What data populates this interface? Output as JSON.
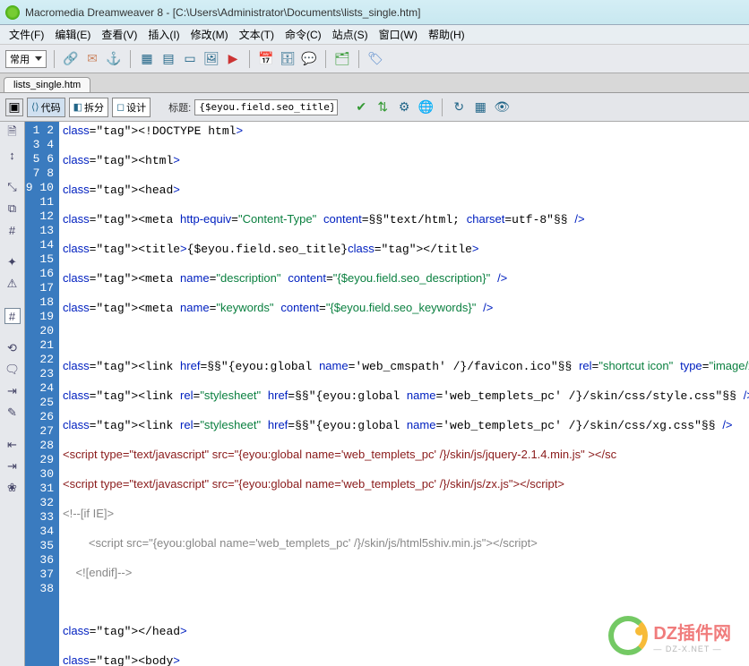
{
  "window": {
    "title": "Macromedia Dreamweaver 8 - [C:\\Users\\Administrator\\Documents\\lists_single.htm]"
  },
  "menus": [
    "文件(F)",
    "编辑(E)",
    "查看(V)",
    "插入(I)",
    "修改(M)",
    "文本(T)",
    "命令(C)",
    "站点(S)",
    "窗口(W)",
    "帮助(H)"
  ],
  "toolbar1": {
    "group_label": "常用"
  },
  "tab": {
    "filename": "lists_single.htm"
  },
  "toolbar2": {
    "code_label": "代码",
    "split_label": "拆分",
    "design_label": "设计",
    "title_label": "标题:",
    "title_value": "{$eyou.field.seo_title}"
  },
  "code_lines": [
    {
      "n": 1,
      "t": "doctype",
      "s": "<!DOCTYPE html>"
    },
    {
      "n": 2,
      "t": "blank",
      "s": ""
    },
    {
      "n": 3,
      "t": "tag",
      "s": "<html>"
    },
    {
      "n": 4,
      "t": "blank",
      "s": ""
    },
    {
      "n": 5,
      "t": "tag",
      "s": "<head>"
    },
    {
      "n": 6,
      "t": "blank",
      "s": ""
    },
    {
      "n": 7,
      "t": "meta",
      "s": "<meta http-equiv=\"Content-Type\" content=\"text/html; charset=utf-8\" />"
    },
    {
      "n": 8,
      "t": "blank",
      "s": ""
    },
    {
      "n": 9,
      "t": "title",
      "s": "<title>{$eyou.field.seo_title}</title>"
    },
    {
      "n": 10,
      "t": "blank",
      "s": ""
    },
    {
      "n": 11,
      "t": "meta",
      "s": "<meta name=\"description\" content=\"{$eyou.field.seo_description}\" />"
    },
    {
      "n": 12,
      "t": "blank",
      "s": ""
    },
    {
      "n": 13,
      "t": "meta",
      "s": "<meta name=\"keywords\" content=\"{$eyou.field.seo_keywords}\" />"
    },
    {
      "n": 14,
      "t": "blank",
      "s": ""
    },
    {
      "n": 15,
      "t": "blank",
      "s": ""
    },
    {
      "n": 16,
      "t": "blank",
      "s": ""
    },
    {
      "n": 17,
      "t": "link",
      "s": "<link href=\"{eyou:global name='web_cmspath' /}/favicon.ico\" rel=\"shortcut icon\" type=\"image/x-icon\" />"
    },
    {
      "n": 18,
      "t": "blank",
      "s": ""
    },
    {
      "n": 19,
      "t": "link",
      "s": "<link rel=\"stylesheet\" href=\"{eyou:global name='web_templets_pc' /}/skin/css/style.css\" />"
    },
    {
      "n": 20,
      "t": "blank",
      "s": ""
    },
    {
      "n": 21,
      "t": "link",
      "s": "<link rel=\"stylesheet\" href=\"{eyou:global name='web_templets_pc' /}/skin/css/xg.css\" />"
    },
    {
      "n": 22,
      "t": "blank",
      "s": ""
    },
    {
      "n": 23,
      "t": "script",
      "s": "<script type=\"text/javascript\" src=\"{eyou:global name='web_templets_pc' /}/skin/js/jquery-2.1.4.min.js\" ></sc"
    },
    {
      "n": 24,
      "t": "blank",
      "s": ""
    },
    {
      "n": 25,
      "t": "script",
      "s": "<script type=\"text/javascript\" src=\"{eyou:global name='web_templets_pc' /}/skin/js/zx.js\"></scr!pt>"
    },
    {
      "n": 26,
      "t": "blank",
      "s": ""
    },
    {
      "n": 27,
      "t": "cmt",
      "s": "<!--[if IE]>"
    },
    {
      "n": 28,
      "t": "blank",
      "s": ""
    },
    {
      "n": 29,
      "t": "cmt",
      "s": "        <script src=\"{eyou:global name='web_templets_pc' /}/skin/js/html5shiv.min.js\"></scr!pt>"
    },
    {
      "n": 30,
      "t": "blank",
      "s": ""
    },
    {
      "n": 31,
      "t": "cmt",
      "s": "    <![endif]-->"
    },
    {
      "n": 32,
      "t": "blank",
      "s": ""
    },
    {
      "n": 33,
      "t": "blank",
      "s": ""
    },
    {
      "n": 34,
      "t": "blank",
      "s": ""
    },
    {
      "n": 35,
      "t": "tag",
      "s": "</head>"
    },
    {
      "n": 36,
      "t": "blank",
      "s": ""
    },
    {
      "n": 37,
      "t": "tag",
      "s": "<body>"
    },
    {
      "n": 38,
      "t": "blank",
      "s": ""
    }
  ],
  "watermark": {
    "main": "DZ插件网",
    "sub": "— DZ-X.NET —"
  }
}
